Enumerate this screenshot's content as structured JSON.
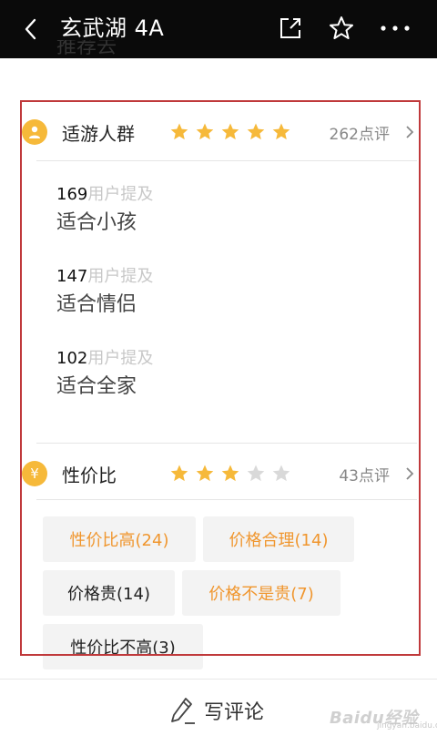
{
  "topbar": {
    "title": "玄武湖 4A",
    "icons": [
      "back-icon",
      "share-icon",
      "star-outline-icon",
      "more-icon"
    ]
  },
  "cut_text": "推荐去",
  "crowd": {
    "badge_icon": "person-icon",
    "title": "适游人群",
    "rating": 5,
    "review_count": "262点评",
    "mentions": [
      {
        "count": "169",
        "unit": "用户提及",
        "label": "适合小孩"
      },
      {
        "count": "147",
        "unit": "用户提及",
        "label": "适合情侣"
      },
      {
        "count": "102",
        "unit": "用户提及",
        "label": "适合全家"
      }
    ]
  },
  "value": {
    "badge_icon": "yen-icon",
    "badge_text": "¥",
    "title": "性价比",
    "rating": 3,
    "review_count": "43点评",
    "tags": [
      {
        "label": "性价比高(24)",
        "tone": "orange"
      },
      {
        "label": "价格合理(14)",
        "tone": "orange"
      },
      {
        "label": "价格贵(14)",
        "tone": "dark"
      },
      {
        "label": "价格不是贵(7)",
        "tone": "orange"
      },
      {
        "label": "性价比不高(3)",
        "tone": "dark"
      }
    ]
  },
  "footer": {
    "write_label": "写评论"
  },
  "watermark": {
    "text": "Baidu经验",
    "sub": "jingyan.baidu.com"
  },
  "colors": {
    "star_filled": "#f6b93a",
    "star_empty": "#d9d9d9",
    "tag_orange": "#f0962e",
    "highlight": "#c0393b",
    "topbar": "#0a0a0a"
  }
}
